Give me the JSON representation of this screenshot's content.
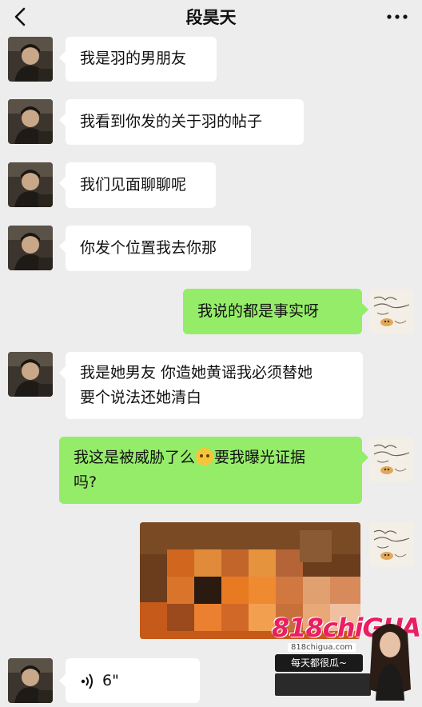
{
  "header": {
    "title": "段昊天"
  },
  "messages": [
    {
      "side": "in",
      "text": "我是羽的男朋友"
    },
    {
      "side": "in",
      "text": "我看到你发的关于羽的帖子"
    },
    {
      "side": "in",
      "text": "我们见面聊聊呢"
    },
    {
      "side": "in",
      "text": "你发个位置我去你那"
    },
    {
      "side": "out",
      "text": "我说的都是事实呀"
    },
    {
      "side": "in",
      "line1": "我是她男友 你造她黄谣我必须替她",
      "line2": "要个说法还她清白"
    },
    {
      "side": "out",
      "line1_a": "我这是被威胁了么",
      "emoji": "flushed-face-emoji",
      "line1_b": "要我曝光证据",
      "line2": "吗?"
    },
    {
      "side": "out",
      "type": "image",
      "content": "pixelated-photo"
    },
    {
      "side": "in",
      "type": "voice",
      "duration": "6\""
    }
  ],
  "watermark": {
    "logo": "818chiGUA",
    "url": "818chigua.com",
    "slogan": "每天都很瓜~"
  },
  "colors": {
    "background": "#ededed",
    "incoming_bubble": "#ffffff",
    "outgoing_bubble": "#95ec69",
    "watermark_accent": "#e91e63"
  },
  "icons": [
    "back-chevron-icon",
    "more-dots-icon",
    "voice-wave-icon"
  ]
}
